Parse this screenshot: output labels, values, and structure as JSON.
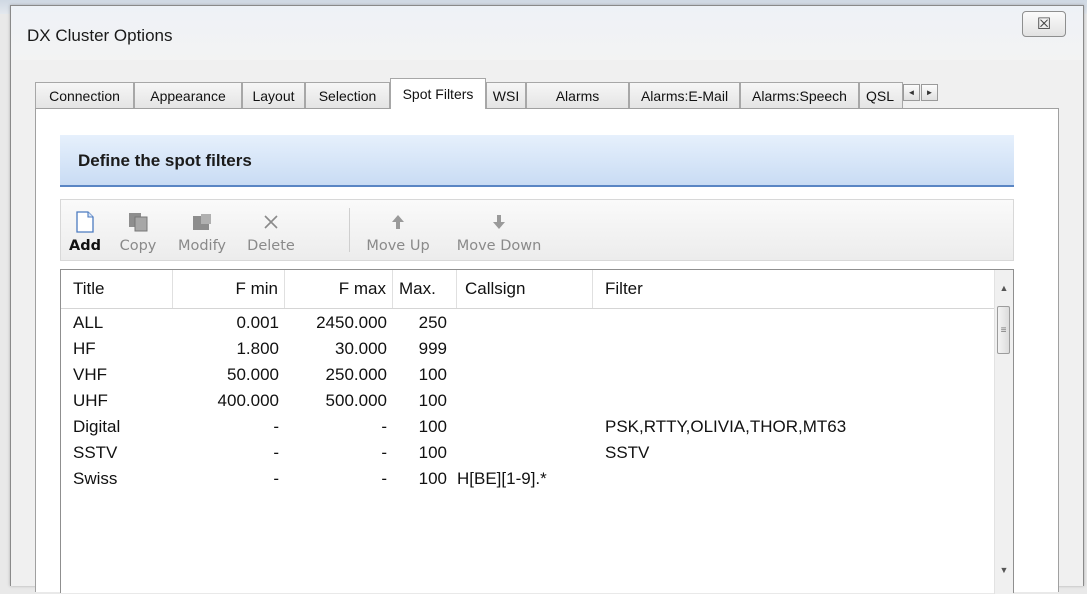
{
  "window": {
    "title": "DX Cluster Options",
    "close_glyph": "☒"
  },
  "tabs": [
    {
      "label": "Connection",
      "active": false
    },
    {
      "label": "Appearance",
      "active": false
    },
    {
      "label": "Layout",
      "active": false
    },
    {
      "label": "Selection",
      "active": false
    },
    {
      "label": "Spot Filters",
      "active": true
    },
    {
      "label": "WSI",
      "active": false
    },
    {
      "label": "Alarms",
      "active": false
    },
    {
      "label": "Alarms:E-Mail",
      "active": false
    },
    {
      "label": "Alarms:Speech",
      "active": false
    },
    {
      "label": "QSL",
      "active": false
    }
  ],
  "tab_scroll": {
    "left": "◄",
    "right": "►"
  },
  "panel": {
    "header": "Define the spot filters"
  },
  "toolbar": {
    "add": "Add",
    "copy": "Copy",
    "modify": "Modify",
    "delete": "Delete",
    "move_up": "Move Up",
    "move_down": "Move Down"
  },
  "table": {
    "columns": [
      "Title",
      "F min",
      "F max",
      "Max.",
      "Callsign",
      "Filter"
    ],
    "rows": [
      {
        "title": "ALL",
        "fmin": "0.001",
        "fmax": "2450.000",
        "max": "250",
        "callsign": "",
        "filter": ""
      },
      {
        "title": "HF",
        "fmin": "1.800",
        "fmax": "30.000",
        "max": "999",
        "callsign": "",
        "filter": ""
      },
      {
        "title": "VHF",
        "fmin": "50.000",
        "fmax": "250.000",
        "max": "100",
        "callsign": "",
        "filter": ""
      },
      {
        "title": "UHF",
        "fmin": "400.000",
        "fmax": "500.000",
        "max": "100",
        "callsign": "",
        "filter": ""
      },
      {
        "title": "Digital",
        "fmin": "-",
        "fmax": "-",
        "max": "100",
        "callsign": "",
        "filter": "PSK,RTTY,OLIVIA,THOR,MT63"
      },
      {
        "title": "SSTV",
        "fmin": "-",
        "fmax": "-",
        "max": "100",
        "callsign": "",
        "filter": "SSTV"
      },
      {
        "title": "Swiss",
        "fmin": "-",
        "fmax": "-",
        "max": "100",
        "callsign": "H[BE][1-9].*",
        "filter": ""
      }
    ]
  },
  "colors": {
    "header_bar": "#c9dcf4",
    "header_line": "#5a86c4",
    "panel": "#ffffff"
  }
}
